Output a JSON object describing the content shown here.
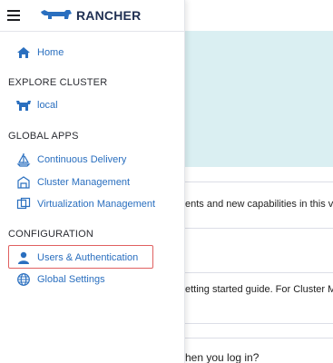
{
  "header": {
    "menu_icon": "hamburger-menu-icon",
    "logo_text": "RANCHER",
    "logo_icon": "rancher-cow-logo"
  },
  "menu": {
    "home": {
      "label": "Home",
      "icon": "home-icon"
    },
    "explore_cluster": {
      "title": "EXPLORE CLUSTER",
      "items": [
        {
          "label": "local",
          "icon": "cluster-cow-icon"
        }
      ]
    },
    "global_apps": {
      "title": "GLOBAL APPS",
      "items": [
        {
          "label": "Continuous Delivery",
          "icon": "sailboat-icon"
        },
        {
          "label": "Cluster Management",
          "icon": "cluster-management-icon"
        },
        {
          "label": "Virtualization Management",
          "icon": "virtualization-icon"
        }
      ]
    },
    "configuration": {
      "title": "CONFIGURATION",
      "items": [
        {
          "label": "Users & Authentication",
          "icon": "user-icon",
          "highlighted": true
        },
        {
          "label": "Global Settings",
          "icon": "globe-icon"
        }
      ]
    }
  },
  "background": {
    "line1": "ents and new capabilities in this vers",
    "line2": "etting started guide. For Cluster Ma",
    "line3": "hen you log in?"
  },
  "colors": {
    "accent": "#2a6fbf",
    "banner": "#daeff2",
    "highlight_border": "#e06060"
  }
}
